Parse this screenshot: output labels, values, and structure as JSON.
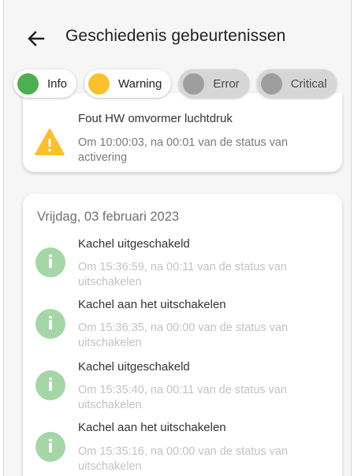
{
  "header": {
    "title": "Geschiedenis gebeurtenissen"
  },
  "filters": [
    {
      "label": "Info",
      "state": "on",
      "color": "#4caf50"
    },
    {
      "label": "Warning",
      "state": "on",
      "color": "#fbc02d"
    },
    {
      "label": "Error",
      "state": "off",
      "color": "#9e9e9e"
    },
    {
      "label": "Critical",
      "state": "off",
      "color": "#9e9e9e"
    }
  ],
  "previous_card": {
    "event": {
      "icon": "warning-icon",
      "title": "Fout HW omvormer luchtdruk",
      "subtitle": "Om 10:00:03, na 00:01 van de status van activering"
    }
  },
  "day_card": {
    "date": "Vrijdag, 03 februari 2023",
    "events": [
      {
        "icon": "info-icon",
        "title": "Kachel uitgeschakeld",
        "subtitle": "Om 15:36:59, na 00:11 van de status van uitschakelen"
      },
      {
        "icon": "info-icon",
        "title": "Kachel aan het uitschakelen",
        "subtitle": "Om 15:36:35, na 00:00 van de status van uitschakelen"
      },
      {
        "icon": "info-icon",
        "title": "Kachel uitgeschakeld",
        "subtitle": "Om 15:35:40, na 00:11 van de status van uitschakelen"
      },
      {
        "icon": "info-icon",
        "title": "Kachel aan het uitschakelen",
        "subtitle": "Om 15:35:16, na 00:00 van de status van uitschakelen"
      }
    ]
  }
}
